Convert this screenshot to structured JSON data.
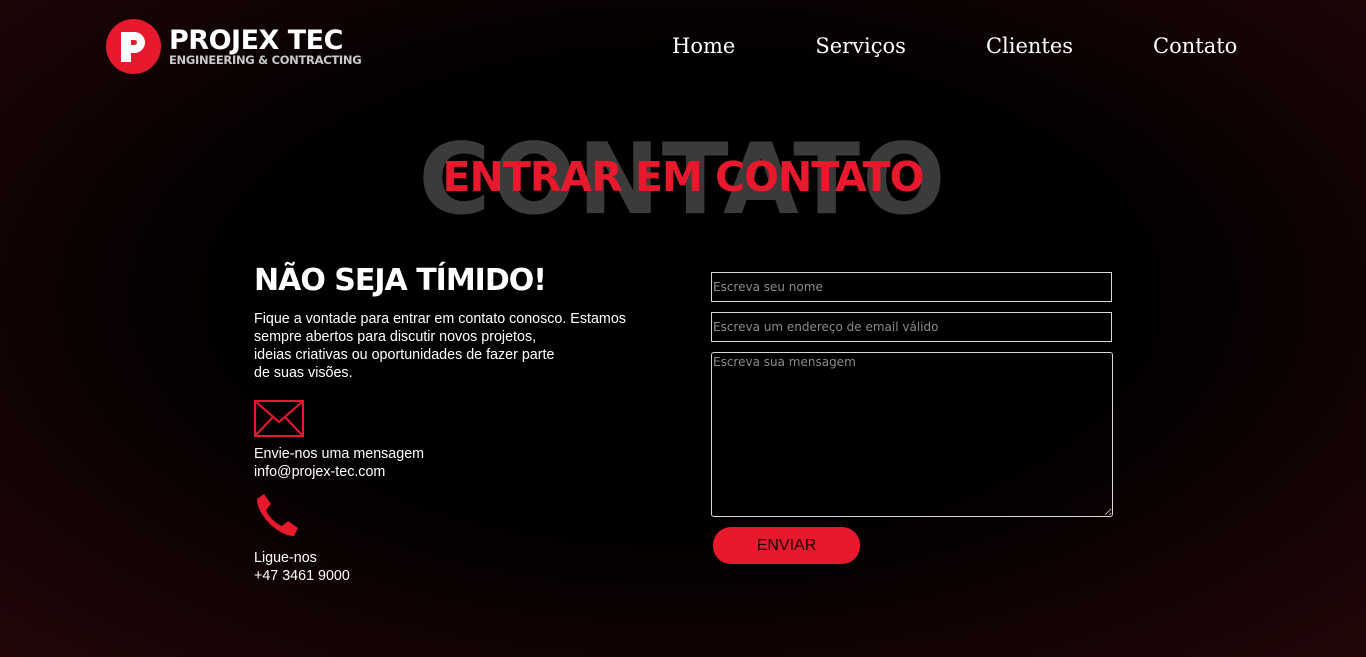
{
  "brand": {
    "name": "PROJEX TEC",
    "tagline": "ENGINEERING & CONTRACTING",
    "accent": "#e8192c",
    "logo_icon": "p-logo-icon"
  },
  "nav": {
    "items": [
      {
        "label": "Home"
      },
      {
        "label": "Serviços"
      },
      {
        "label": "Clientes"
      },
      {
        "label": "Contato"
      }
    ]
  },
  "hero": {
    "background_text": "CONTATO",
    "title": "ENTRAR EM CONTATO"
  },
  "contact": {
    "heading": "NÃO SEJA TÍMIDO!",
    "intro_lines": [
      "Fique a vontade para entrar em contato conosco. Estamos",
      "sempre abertos para discutir novos projetos,",
      "ideias criativas ou oportunidades de fazer parte",
      "de suas visões."
    ],
    "email": {
      "icon": "envelope-icon",
      "label": "Envie-nos uma mensagem",
      "value": "info@projex-tec.com"
    },
    "phone": {
      "icon": "phone-icon",
      "label": "Ligue-nos",
      "value": "+47 3461 9000"
    }
  },
  "form": {
    "name_placeholder": "Escreva seu nome",
    "email_placeholder": "Escreva um endereço de email válido",
    "message_placeholder": "Escreva sua mensagem",
    "submit_label": "ENVIAR"
  }
}
